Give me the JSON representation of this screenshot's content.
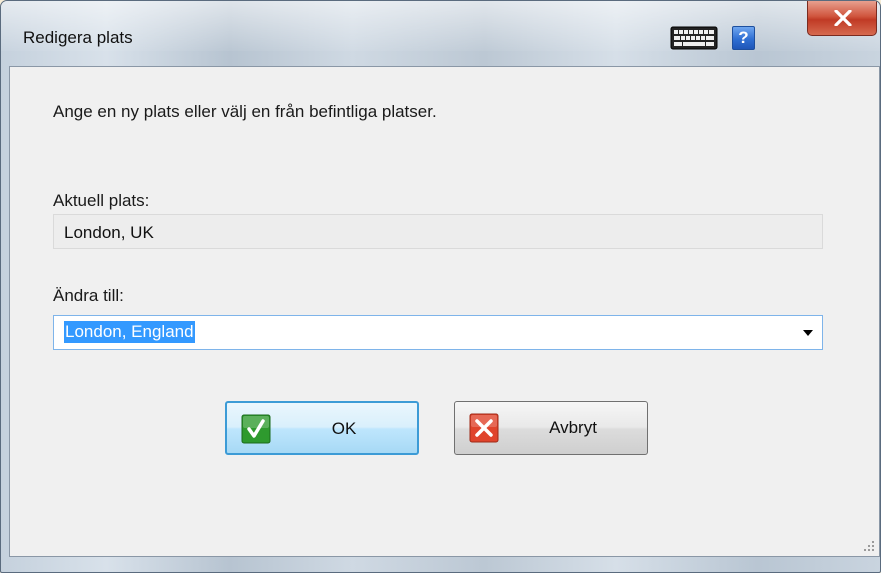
{
  "window": {
    "title": "Redigera plats",
    "help_label": "?"
  },
  "dialog": {
    "instruction": "Ange en ny plats eller välj en från befintliga platser.",
    "current_label": "Aktuell plats:",
    "current_value": "London, UK",
    "change_label": "Ändra till:",
    "change_value": "London, England"
  },
  "buttons": {
    "ok_label": "OK",
    "cancel_label": "Avbryt"
  },
  "colors": {
    "ok_icon": "#2e9a2e",
    "cancel_icon": "#e0442c",
    "selection": "#3399ff"
  }
}
